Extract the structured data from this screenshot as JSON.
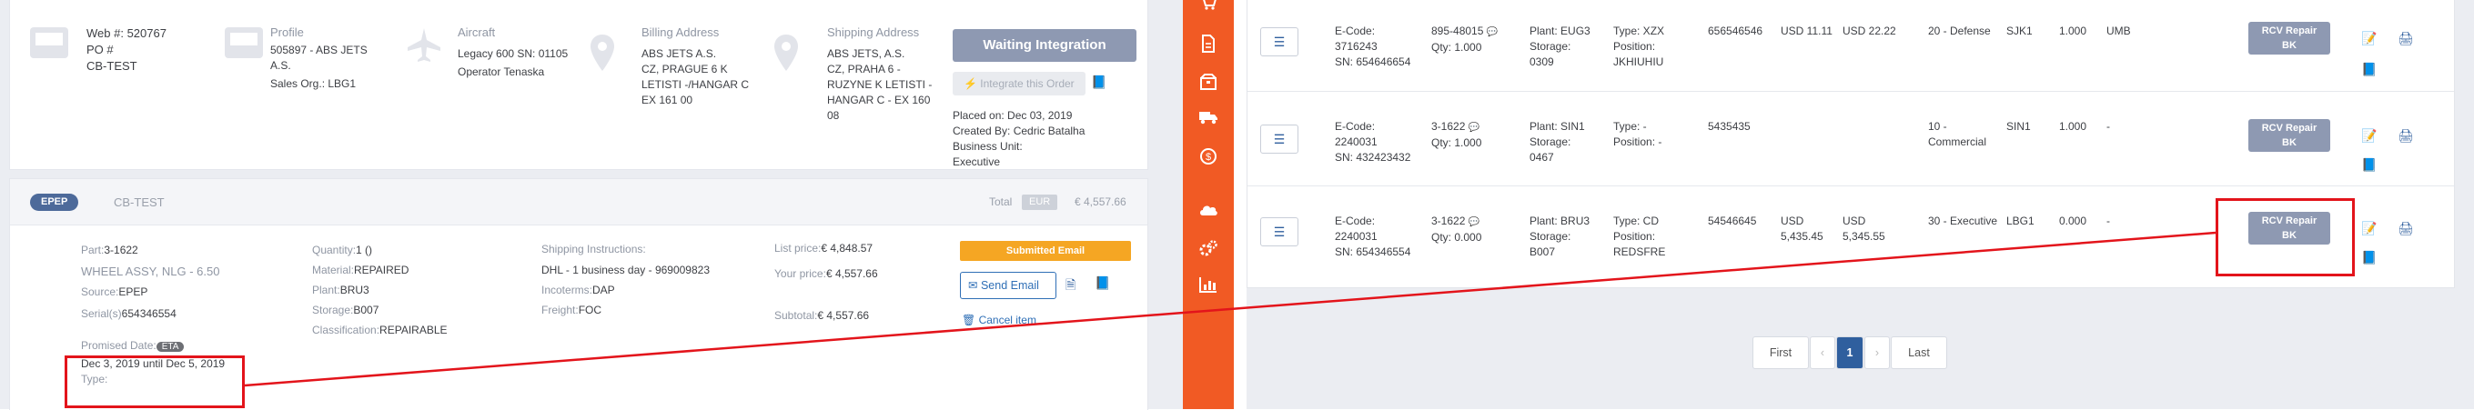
{
  "order": {
    "web_label": "Web #:",
    "web_value": "520767",
    "po_label": "PO #",
    "customer": "CB-TEST",
    "profile_label": "Profile",
    "profile_lines": [
      "505897 - ABS JETS",
      "A.S."
    ],
    "sales_org": "Sales Org.: LBG1",
    "aircraft_label": "Aircraft",
    "aircraft_line": "Legacy 600 SN: 01105",
    "operator": "Operator Tenaska",
    "billing_label": "Billing Address",
    "billing_lines": [
      "ABS JETS A.S.",
      "CZ, PRAGUE 6 K",
      "LETISTI -/HANGAR C",
      "EX 161 00"
    ],
    "shipping_label": "Shipping Address",
    "shipping_lines": [
      "ABS JETS, A.S.",
      "CZ, PRAHA 6 -",
      "RUZYNE K LETISTI -",
      "HANGAR C - EX 160",
      "08"
    ],
    "status_button": "Waiting Integration",
    "integrate_button": "Integrate this Order",
    "placed_on": "Placed on: Dec 03, 2019",
    "created_by": "Created By: Cedric Batalha",
    "business_unit_label": "Business Unit:",
    "business_unit": "Executive"
  },
  "item": {
    "badge": "EPEP",
    "customer": "CB-TEST",
    "total_label": "Total",
    "currency": "EUR",
    "total_value": "€ 4,557.66",
    "part_label": "Part:",
    "part_value": "3-1622",
    "description": "WHEEL ASSY, NLG - 6.50",
    "source_label": "Source:",
    "source_value": "EPEP",
    "serial_label": "Serial(s)",
    "serial_value": "654346554",
    "promised_label": "Promised Date:",
    "eta": "ETA",
    "date_range": "Dec 3, 2019 until Dec 5, 2019",
    "type_label": "Type:",
    "quantity_label": "Quantity:",
    "quantity_value": "1 ()",
    "material_label": "Material:",
    "material_value": "REPAIRED",
    "plant_label": "Plant:",
    "plant_value": "BRU3",
    "storage_label": "Storage:",
    "storage_value": "B007",
    "classification_label": "Classification:",
    "classification_value": "REPAIRABLE",
    "shipping_instr_label": "Shipping Instructions:",
    "shipping_instr_value": "DHL - 1 business day - 969009823",
    "incoterms_label": "Incoterms:",
    "incoterms_value": "DAP",
    "freight_label": "Freight:",
    "freight_value": "FOC",
    "list_price_label": "List price:",
    "list_price_value": "€ 4,848.57",
    "your_price_label": "Your price:",
    "your_price_value": "€ 4,557.66",
    "subtotal_label": "Subtotal:",
    "subtotal_value": "€ 4,557.66",
    "submitted_email": "Submitted Email",
    "send_email": "Send Email",
    "cancel_item": "Cancel item"
  },
  "sidebar_icons": [
    "cart-icon",
    "document-icon",
    "box-icon",
    "truck-icon",
    "money-icon",
    "cloud-icon",
    "gears-icon",
    "chart-icon"
  ],
  "rows": [
    {
      "ecode_lines": [
        "E-Code:",
        "3716243",
        "SN: 654646654"
      ],
      "part": "895-48015",
      "qty": "Qty: 1.000",
      "plant": "Plant: EUG3",
      "storage_lines": [
        "Storage:",
        "0309"
      ],
      "type": "Type: XZX",
      "position_lines": [
        "Position:",
        "JKHIUHIU"
      ],
      "ref": "656546546",
      "price1": "USD 11.11",
      "price2": "USD 22.22",
      "segment_lines": [
        "20 - Defense"
      ],
      "plant_code": "SJK1",
      "qty_value": "1.000",
      "uom": "UMB",
      "rcv": [
        "RCV Repair",
        "BK"
      ]
    },
    {
      "ecode_lines": [
        "E-Code:",
        "2240031",
        "SN: 432423432"
      ],
      "part": "3-1622",
      "qty": "Qty: 1.000",
      "plant": "Plant: SIN1",
      "storage_lines": [
        "Storage:",
        "0467"
      ],
      "type": "Type: -",
      "position_lines": [
        "Position: -"
      ],
      "ref": "5435435",
      "price1": "",
      "price2": "",
      "segment_lines": [
        "10 -",
        "Commercial"
      ],
      "plant_code": "SIN1",
      "qty_value": "1.000",
      "uom": "-",
      "rcv": [
        "RCV Repair",
        "BK"
      ]
    },
    {
      "ecode_lines": [
        "E-Code:",
        "2240031",
        "SN: 654346554"
      ],
      "part": "3-1622",
      "qty": "Qty: 0.000",
      "plant": "Plant: BRU3",
      "storage_lines": [
        "Storage:",
        "B007"
      ],
      "type": "Type: CD",
      "position_lines": [
        "Position:",
        "REDSFRE"
      ],
      "ref": "54546645",
      "price1": "USD 5,435.45",
      "price2": "USD 5,345.55",
      "segment_lines": [
        "30 - Executive"
      ],
      "plant_code": "LBG1",
      "qty_value": "0.000",
      "uom": "-",
      "rcv": [
        "RCV Repair",
        "BK"
      ]
    }
  ],
  "pagination": {
    "first": "First",
    "prev": "‹",
    "page": "1",
    "next": "›",
    "last": "Last"
  }
}
